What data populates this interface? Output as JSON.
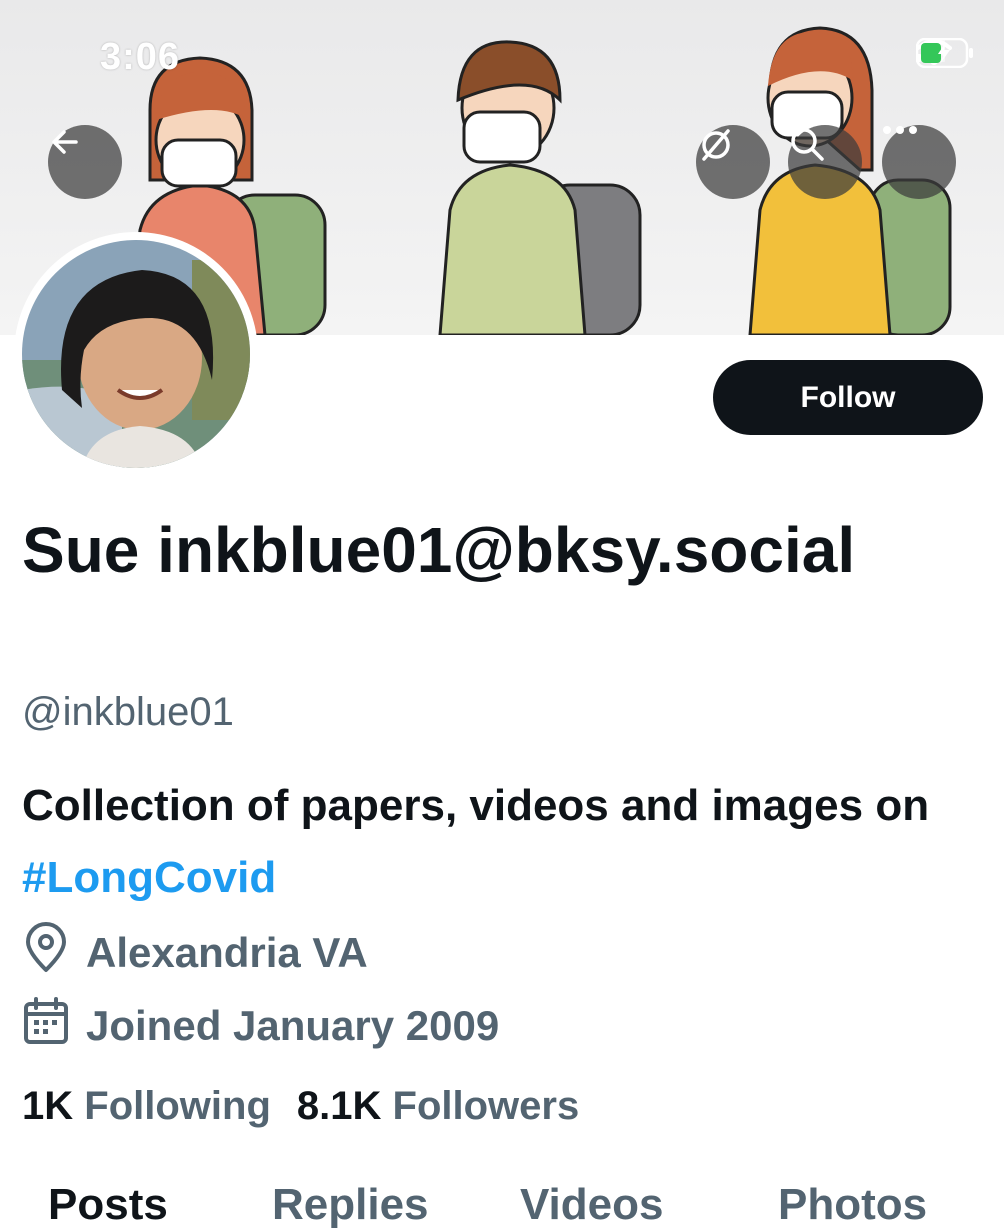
{
  "status_bar": {
    "time": "3:06"
  },
  "profile": {
    "display_name": "Sue inkblue01@bksy.social",
    "handle": "@inkblue01",
    "bio_text": "Collection of papers, videos and images on ",
    "bio_hashtag": "#LongCovid",
    "location": "Alexandria VA",
    "joined": "Joined January 2009"
  },
  "actions": {
    "follow_label": "Follow"
  },
  "stats": {
    "following_count": "1K",
    "following_label": "Following",
    "followers_count": "8.1K",
    "followers_label": "Followers"
  },
  "tabs": [
    {
      "label": "Posts"
    },
    {
      "label": "Replies"
    },
    {
      "label": "Videos"
    },
    {
      "label": "Photos"
    }
  ],
  "colors": {
    "accent": "#1d9bf0",
    "text": "#0f1419",
    "secondary": "#536471",
    "button_bg": "#0f1419",
    "battery": "#34c759"
  },
  "icons": [
    "back-arrow-icon",
    "translate-icon",
    "search-icon",
    "more-icon",
    "location-pin-icon",
    "calendar-icon",
    "wifi-icon",
    "battery-icon",
    "signal-icon"
  ]
}
